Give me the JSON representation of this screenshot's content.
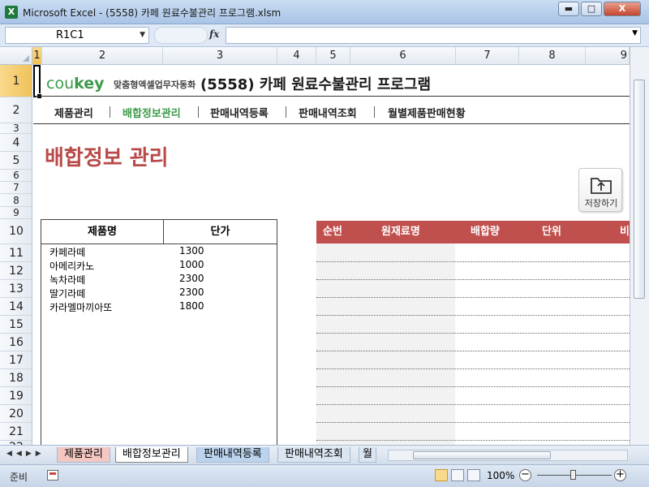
{
  "window": {
    "title": "Microsoft Excel - (5558) 카페 원료수불관리 프로그램.xlsm",
    "min_label": "▬",
    "max_label": "□",
    "close_label": "X"
  },
  "formula": {
    "name_box": "R1C1",
    "fx_label": "fx"
  },
  "columns": [
    "1",
    "2",
    "3",
    "4",
    "5",
    "6",
    "7",
    "8",
    "9"
  ],
  "rows": [
    "1",
    "2",
    "3",
    "4",
    "5",
    "6",
    "7",
    "8",
    "9",
    "10",
    "11",
    "12",
    "13",
    "14",
    "15",
    "16",
    "17",
    "18",
    "19",
    "20",
    "21",
    "22"
  ],
  "header": {
    "logo_prefix": "cou",
    "logo_key": "key",
    "logo_sub": "맞춤형엑셀업무자동화",
    "app_title": "(5558) 카페 원료수불관리 프로그램"
  },
  "nav": {
    "items": [
      "제품관리",
      "배합정보관리",
      "판매내역등록",
      "판매내역조회",
      "월별제품판매현황"
    ]
  },
  "section_title": "배합정보 관리",
  "save_button_label": "저장하기",
  "product_table": {
    "headers": [
      "제품명",
      "단가"
    ],
    "rows": [
      {
        "name": "카페라떼",
        "price": "1300"
      },
      {
        "name": "아메리카노",
        "price": "1000"
      },
      {
        "name": "녹차라떼",
        "price": "2300"
      },
      {
        "name": "딸기라떼",
        "price": "2300"
      },
      {
        "name": "카라멜마끼아또",
        "price": "1800"
      }
    ]
  },
  "recipe_table": {
    "headers": [
      "순번",
      "원재료명",
      "배합량",
      "단위",
      "비"
    ]
  },
  "sheet_tabs": [
    "제품관리",
    "배합정보관리",
    "판매내역등록",
    "판매내역조회",
    "월"
  ],
  "status": {
    "ready": "준비",
    "zoom": "100%"
  },
  "colors": {
    "accent_green": "#3d9a4a",
    "title_red": "#b94a4a",
    "table_header_red": "#c0504d"
  }
}
